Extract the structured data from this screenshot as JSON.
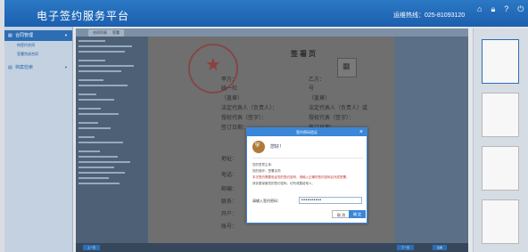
{
  "header": {
    "title": "电子签约服务平台",
    "hotline": "运维热线：025-81093120",
    "icons": [
      "home-icon",
      "lock-icon",
      "help-icon",
      "power-icon"
    ]
  },
  "sidebar": {
    "groups": [
      {
        "label": "合同管理",
        "items": [
          "待签约合同",
          "签署完成合同"
        ]
      },
      {
        "label": "档案检索",
        "items": []
      }
    ]
  },
  "tabs": [
    "合同列表",
    "签署"
  ],
  "document": {
    "title": "签署页",
    "rows": [
      {
        "left": "甲方：",
        "right": "乙方："
      },
      {
        "left": "统一社",
        "right": "号"
      },
      {
        "left": "（盖章）",
        "right": "（盖章）"
      },
      {
        "left": "法定代表人（负责人）：",
        "right": "法定代表人（负责人）或"
      },
      {
        "left": "授权代表（签字）：",
        "right": "授权代表（签字）："
      },
      {
        "left": "签订日期：",
        "right": "签订日期："
      }
    ],
    "lower_rows": [
      "地址：",
      "电话：",
      "邮编：",
      "联系：",
      "开户：",
      "账号："
    ]
  },
  "modal": {
    "title": "签约密码验证",
    "close": "×",
    "greeting": "您好！",
    "text_lines": [
      "您的签章主体：",
      "您的操作：签署合同",
      "本次签约需要验证您的签约密码，请输入正确的签约密码后完成签署。",
      "请妥善保管您的签约密码，切勿泄露给他人。"
    ],
    "password_label": "请输入签约密码：",
    "password_value": "••••••••••",
    "cancel_label": "取 消",
    "ok_label": "确 定"
  },
  "bottom_buttons": [
    "上一页",
    "下一页",
    "签署"
  ]
}
